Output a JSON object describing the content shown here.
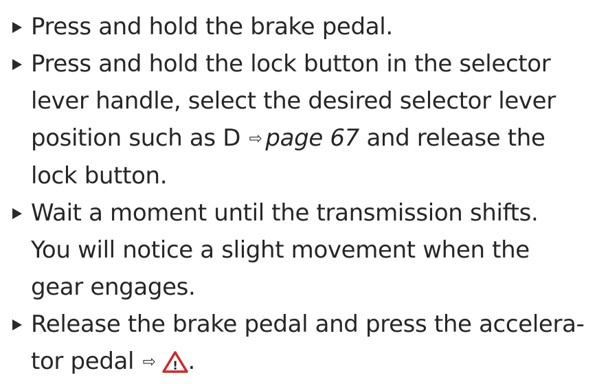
{
  "steps": [
    {
      "text": "Press and hold the brake pedal."
    },
    {
      "text_before": "Press and hold the lock button in the selector lever handle, select the desired selector lever position such as D",
      "page_ref": "page 67",
      "text_after": "and release the lock button."
    },
    {
      "text": "Wait a moment until the transmission shifts. You will notice a slight movement when the gear engages."
    },
    {
      "text_line1": "Release the brake pedal and press the accelera-",
      "text_line2": "tor pedal",
      "end": "."
    }
  ],
  "icons": {
    "bullet": "triangle-right-bullet-icon",
    "reference_arrow": "⇨",
    "warning": "warning-triangle-icon",
    "warning_mark": "!"
  },
  "colors": {
    "text": "#262626",
    "warning_red": "#d0262a"
  }
}
